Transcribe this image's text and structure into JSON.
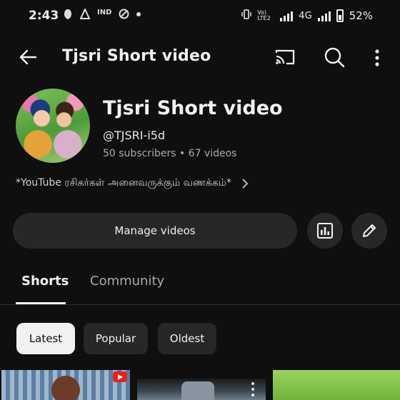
{
  "status_bar": {
    "time": "2:43",
    "network_label": "Vo) LTE2",
    "network_type": "4G",
    "battery": "52%"
  },
  "app_bar": {
    "title": "Tjsri Short video"
  },
  "channel": {
    "name": "Tjsri Short video",
    "handle": "@TJSRI-i5d",
    "stats": "50 subscribers • 67 videos",
    "description": "*YouTube ரசிகர்கள் அனைவருக்கும் வணக்கம்*"
  },
  "actions": {
    "manage_videos": "Manage videos"
  },
  "tabs": [
    {
      "label": "Shorts",
      "active": true
    },
    {
      "label": "Community",
      "active": false
    }
  ],
  "chips": [
    {
      "label": "Latest",
      "selected": true
    },
    {
      "label": "Popular",
      "selected": false
    },
    {
      "label": "Oldest",
      "selected": false
    }
  ],
  "colors": {
    "background": "#0f0f0f",
    "surface": "#272727",
    "text_primary": "#f1f1f1",
    "text_secondary": "#aaaaaa",
    "accent_red": "#e62117"
  }
}
